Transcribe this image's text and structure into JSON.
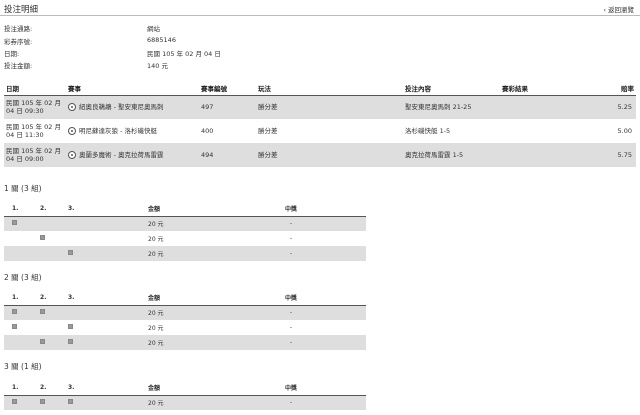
{
  "header": {
    "title": "投注明細",
    "back_label": "‹ 返回瀏覽"
  },
  "info": [
    {
      "label": "投注通路:",
      "value": "網站"
    },
    {
      "label": "彩券序號:",
      "value": "6885146"
    },
    {
      "label": "日期:",
      "value": "民國 105 年 02 月 04 日"
    },
    {
      "label": "投注金額:",
      "value": "140 元"
    }
  ],
  "bets": {
    "headers": [
      "日期",
      "賽事",
      "賽事編號",
      "玩法",
      "投注內容",
      "賽彩結果",
      "賠率"
    ],
    "rows": [
      {
        "date": "民國 105 年 02 月 04 日 09:30",
        "match": "紐奧良鵜鶘 - 聖安東尼奧馬刺",
        "no": "497",
        "play": "勝分差",
        "pick": "聖安東尼奧馬刺 21-25",
        "result": "",
        "odds": "5.25"
      },
      {
        "date": "民國 105 年 02 月 04 日 11:30",
        "match": "明尼蘇達灰狼 - 洛杉磯快艇",
        "no": "400",
        "play": "勝分差",
        "pick": "洛杉磯快艇 1-5",
        "result": "",
        "odds": "5.00"
      },
      {
        "date": "民國 105 年 02 月 04 日 09:00",
        "match": "奧蘭多魔術 - 奧克拉荷馬雷霆",
        "no": "494",
        "play": "勝分差",
        "pick": "奧克拉荷馬雷霆 1-5",
        "result": "",
        "odds": "5.75"
      }
    ]
  },
  "combos": [
    {
      "title": "1 關 (3 組)",
      "headers": [
        "1.",
        "2.",
        "3.",
        "金額",
        "中獎"
      ],
      "rows": [
        {
          "checks": [
            true,
            false,
            false
          ],
          "amount": "20 元",
          "win": "-"
        },
        {
          "checks": [
            false,
            true,
            false
          ],
          "amount": "20 元",
          "win": "-"
        },
        {
          "checks": [
            false,
            false,
            true
          ],
          "amount": "20 元",
          "win": "-"
        }
      ]
    },
    {
      "title": "2 關 (3 組)",
      "headers": [
        "1.",
        "2.",
        "3.",
        "金額",
        "中獎"
      ],
      "rows": [
        {
          "checks": [
            true,
            true,
            false
          ],
          "amount": "20 元",
          "win": "-"
        },
        {
          "checks": [
            true,
            false,
            true
          ],
          "amount": "20 元",
          "win": "-"
        },
        {
          "checks": [
            false,
            true,
            true
          ],
          "amount": "20 元",
          "win": "-"
        }
      ]
    },
    {
      "title": "3 關 (1 組)",
      "headers": [
        "1.",
        "2.",
        "3.",
        "金額",
        "中獎"
      ],
      "rows": [
        {
          "checks": [
            true,
            true,
            true
          ],
          "amount": "20 元",
          "win": "-"
        }
      ]
    }
  ]
}
